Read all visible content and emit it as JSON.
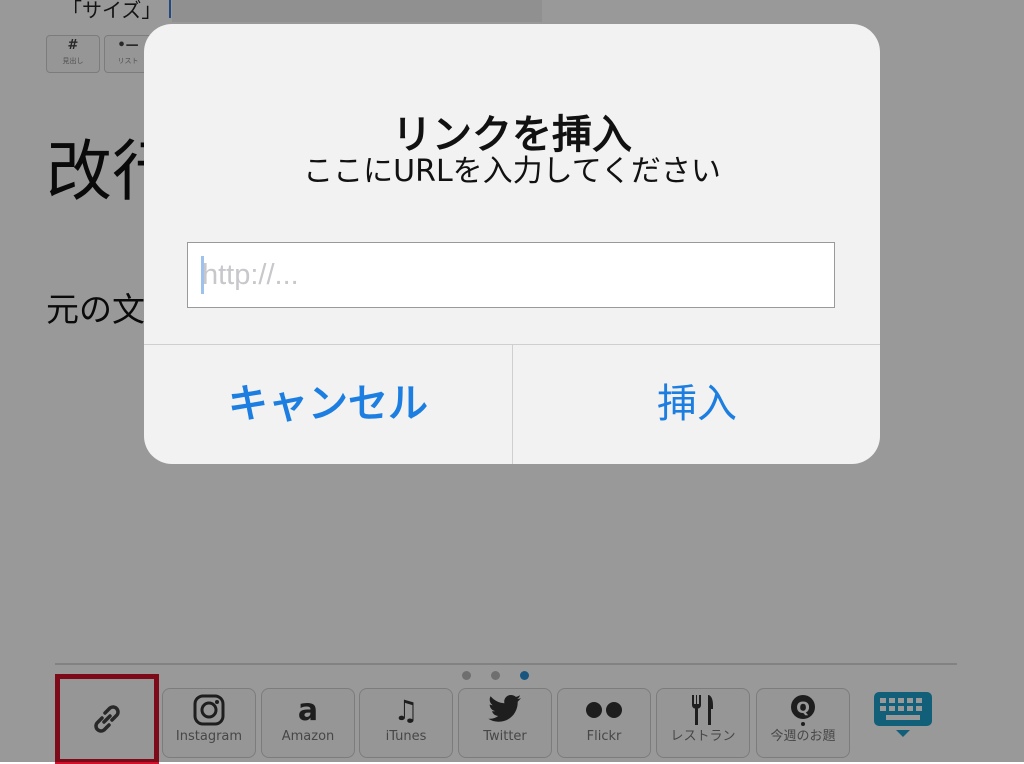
{
  "editor": {
    "size_label": "「サイズ」",
    "mini_buttons": [
      {
        "glyph": "#",
        "sub": "見出し"
      },
      {
        "glyph": "•—",
        "sub": "リスト"
      }
    ],
    "heading_text": "改行",
    "body_text": "元の文"
  },
  "pager": {
    "count": 3,
    "active_index": 2
  },
  "toolbar": {
    "link_icon": "link-icon",
    "items": [
      {
        "icon": "instagram-icon",
        "label": "Instagram"
      },
      {
        "icon": "amazon-icon",
        "label": "Amazon"
      },
      {
        "icon": "music-note-icon",
        "label": "iTunes"
      },
      {
        "icon": "twitter-bird-icon",
        "label": "Twitter"
      },
      {
        "icon": "flickr-icon",
        "label": "Flickr"
      },
      {
        "icon": "fork-knife-icon",
        "label": "レストラン"
      },
      {
        "icon": "question-bubble-icon",
        "label": "今週のお題"
      }
    ],
    "keyboard_icon": "keyboard-hide-icon",
    "highlight_color": "#d0112b"
  },
  "alert": {
    "title": "リンクを挿入",
    "message": "ここにURLを入力してください",
    "input_placeholder": "http://...",
    "input_value": "",
    "cancel_label": "キャンセル",
    "insert_label": "挿入",
    "button_color": "#1c7ee0"
  }
}
